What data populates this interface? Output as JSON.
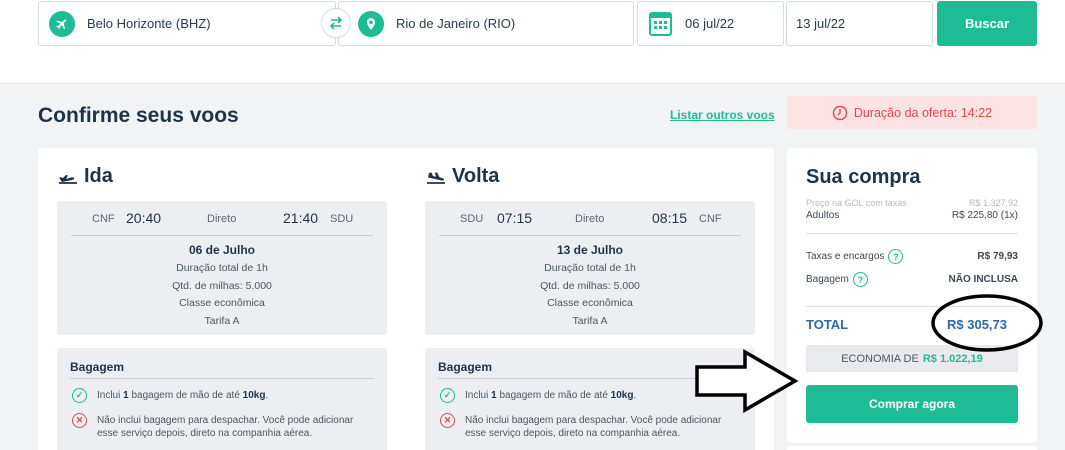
{
  "search": {
    "origin": "Belo Horizonte (BHZ)",
    "destination": "Rio de Janeiro (RIO)",
    "departure": "06 jul/22",
    "return": "13 jul/22",
    "search_label": "Buscar"
  },
  "header": {
    "title": "Confirme seus voos",
    "other_flights": "Listar outros voos",
    "offer": "Duração da oferta: 14:22"
  },
  "outbound": {
    "title": "Ida",
    "from": "CNF",
    "dep_time": "20:40",
    "type": "Direto",
    "arr_time": "21:40",
    "to": "SDU",
    "date": "06 de Julho",
    "duration": "Duração total de 1h",
    "miles": "Qtd. de milhas: 5.000",
    "cabin": "Classe econômica",
    "fare": "Tarifa A",
    "baggage_title": "Bagagem",
    "bag_inc_pre": "Inclui ",
    "bag_inc_qty": "1",
    "bag_inc_mid": " bagagem de mão de até ",
    "bag_inc_kg": "10kg",
    "bag_inc_end": ".",
    "bag_exc": "Não inclui bagagem para despachar. Você pode adicionar esse serviço depois, direto na companhia aérea."
  },
  "inbound": {
    "title": "Volta",
    "from": "SDU",
    "dep_time": "07:15",
    "type": "Direto",
    "arr_time": "08:15",
    "to": "CNF",
    "date": "13 de Julho",
    "duration": "Duração total de 1h",
    "miles": "Qtd. de milhas: 5.000",
    "cabin": "Classe econômica",
    "fare": "Tarifa A",
    "baggage_title": "Bagagem",
    "bag_inc_pre": "Inclui ",
    "bag_inc_qty": "1",
    "bag_inc_mid": " bagagem de mão de até ",
    "bag_inc_kg": "10kg",
    "bag_inc_end": ".",
    "bag_exc": "Não inclui bagagem para despachar. Você pode adicionar esse serviço depois, direto na companhia aérea."
  },
  "purchase": {
    "title": "Sua compra",
    "gol_label": "Preço na GOL com taxas",
    "gol_price": "R$ 1.327,92",
    "adults_label": "Adultos",
    "adults_price": "R$ 225,80 (1x)",
    "taxes_label": "Taxas e encargos",
    "taxes_value": "R$ 79,93",
    "baggage_label": "Bagagem",
    "baggage_value": "NÃO INCLUSA",
    "total_label": "TOTAL",
    "total_value": "R$ 305,73",
    "economy_label": "ECONOMIA DE",
    "economy_value": "R$ 1.022,19",
    "buy_label": "Comprar agora"
  },
  "colors": {
    "accent": "#1ebc94",
    "navy": "#1f3348",
    "total": "#2a6aa5",
    "alert": "#e04848"
  },
  "icons": [
    "plane-icon",
    "location-pin-icon",
    "swap-arrows-icon",
    "calendar-icon",
    "clock-icon",
    "plane-takeoff-icon",
    "plane-landing-icon",
    "check-circle-icon",
    "x-circle-icon",
    "question-icon"
  ]
}
